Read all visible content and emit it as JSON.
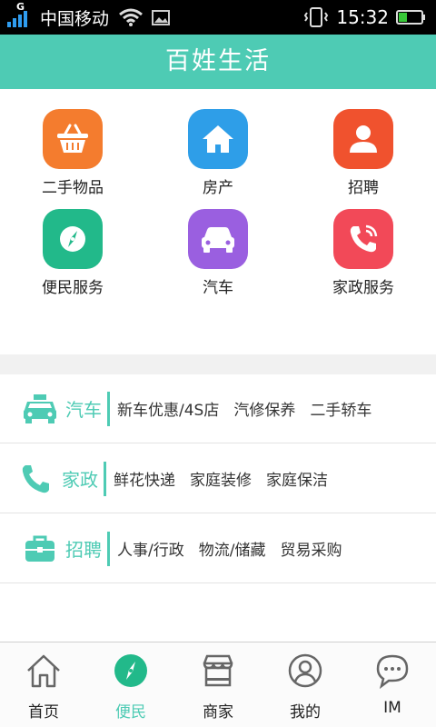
{
  "status_bar": {
    "network_letter": "G",
    "carrier": "中国移动",
    "time": "15:32"
  },
  "app": {
    "title": "百姓生活"
  },
  "grid": [
    {
      "label": "二手物品",
      "icon": "basket-icon",
      "color": "#f47c2e"
    },
    {
      "label": "房产",
      "icon": "house-icon",
      "color": "#2e9ee8"
    },
    {
      "label": "招聘",
      "icon": "person-icon",
      "color": "#f0522e"
    },
    {
      "label": "便民服务",
      "icon": "compass-icon",
      "color": "#22b98a"
    },
    {
      "label": "汽车",
      "icon": "car-icon",
      "color": "#9a5fe0"
    },
    {
      "label": "家政服务",
      "icon": "phone-icon",
      "color": "#f24958"
    }
  ],
  "categories": [
    {
      "title": "汽车",
      "icon": "car-icon",
      "links": [
        "新车优惠/4S店",
        "汽修保养",
        "二手轿车"
      ]
    },
    {
      "title": "家政",
      "icon": "phone-icon",
      "links": [
        "鲜花快递",
        "家庭装修",
        "家庭保洁"
      ]
    },
    {
      "title": "招聘",
      "icon": "briefcase-icon",
      "links": [
        "人事/行政",
        "物流/储藏",
        "贸易采购"
      ]
    }
  ],
  "tabs": [
    {
      "label": "首页",
      "icon": "home-icon",
      "active": false
    },
    {
      "label": "便民",
      "icon": "compass-icon",
      "active": true
    },
    {
      "label": "商家",
      "icon": "store-icon",
      "active": false
    },
    {
      "label": "我的",
      "icon": "user-icon",
      "active": false
    },
    {
      "label": "IM",
      "icon": "chat-icon",
      "active": false
    }
  ],
  "colors": {
    "accent": "#4ecbb4",
    "statusbar": "#000000"
  }
}
